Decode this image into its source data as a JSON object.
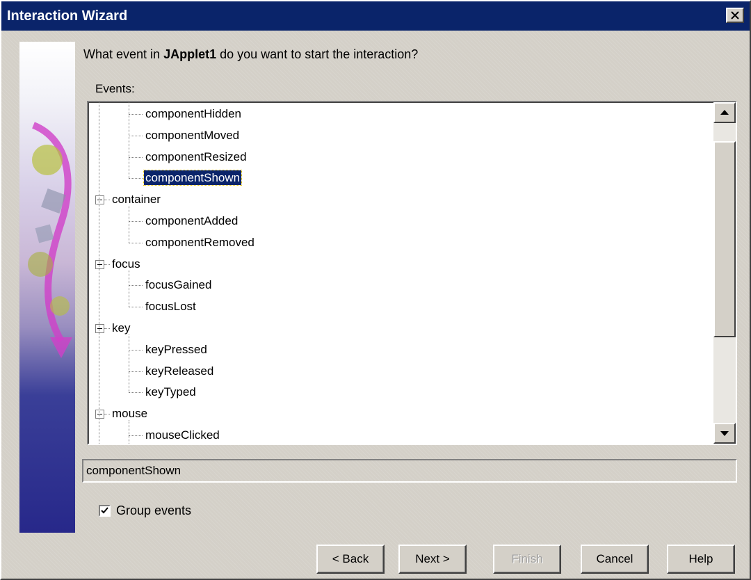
{
  "window": {
    "title": "Interaction Wizard"
  },
  "question": {
    "prefix": "What event in",
    "component": "JApplet1",
    "suffix": "do you want to start the interaction?"
  },
  "events_label": "Events:",
  "tree": [
    {
      "label": "componentHidden",
      "level": 1
    },
    {
      "label": "componentMoved",
      "level": 1
    },
    {
      "label": "componentResized",
      "level": 1
    },
    {
      "label": "componentShown",
      "level": 1,
      "selected": true
    },
    {
      "label": "container",
      "level": 0,
      "expanded": true
    },
    {
      "label": "componentAdded",
      "level": 1
    },
    {
      "label": "componentRemoved",
      "level": 1
    },
    {
      "label": "focus",
      "level": 0,
      "expanded": true
    },
    {
      "label": "focusGained",
      "level": 1
    },
    {
      "label": "focusLost",
      "level": 1
    },
    {
      "label": "key",
      "level": 0,
      "expanded": true
    },
    {
      "label": "keyPressed",
      "level": 1
    },
    {
      "label": "keyReleased",
      "level": 1
    },
    {
      "label": "keyTyped",
      "level": 1
    },
    {
      "label": "mouse",
      "level": 0,
      "expanded": true
    },
    {
      "label": "mouseClicked",
      "level": 1
    }
  ],
  "selection_value": "componentShown",
  "group_events": {
    "label": "Group events",
    "checked": true
  },
  "buttons": {
    "back": "< Back",
    "next": "Next >",
    "finish": "Finish",
    "cancel": "Cancel",
    "help": "Help"
  },
  "colors": {
    "titlebar": "#0a246a",
    "selection": "#0a246a",
    "face": "#d4d0c8"
  }
}
